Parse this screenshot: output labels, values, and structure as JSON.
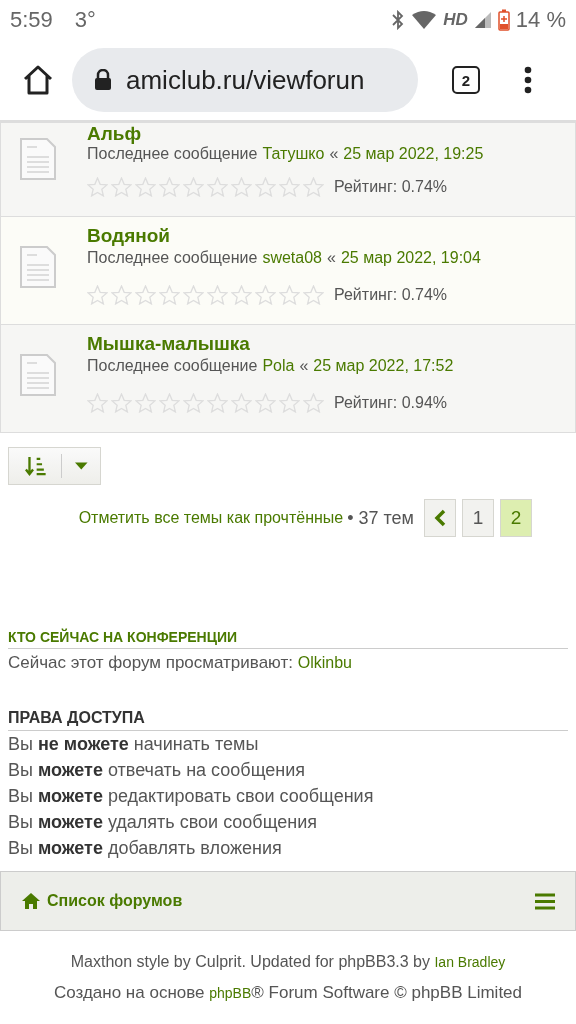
{
  "status_bar": {
    "time": "5:59",
    "temperature": "3°",
    "network": "HD",
    "battery": "14 %"
  },
  "browser": {
    "url": "amiclub.ru/viewforun",
    "tab_count": "2"
  },
  "topics": [
    {
      "title": "Альф",
      "last_post_label": "Последнее сообщение",
      "author": "Татушко",
      "separator": "«",
      "date": "25 мар 2022, 19:25",
      "stars": 0,
      "rating": "Рейтинг: 0.74%"
    },
    {
      "title": "Водяной",
      "last_post_label": "Последнее сообщение",
      "author": "sweta08",
      "separator": "«",
      "date": "25 мар 2022, 19:04",
      "stars": 0,
      "rating": "Рейтинг: 0.74%"
    },
    {
      "title": "Мышка-малышка",
      "last_post_label": "Последнее сообщение",
      "author": "Pola",
      "separator": "«",
      "date": "25 мар 2022, 17:52",
      "stars": 0,
      "rating": "Рейтинг: 0.94%"
    }
  ],
  "mark_read_link": "Отметить все темы как прочтённые",
  "topic_count": "• 37 тем",
  "pagination": [
    {
      "label": "1",
      "selected": false
    },
    {
      "label": "2",
      "selected": true
    }
  ],
  "who_online": {
    "heading": "КТО СЕЙЧАС НА КОНФЕРЕНЦИИ",
    "text": "Сейчас этот форум просматривают:",
    "user": "Olkinbu"
  },
  "permissions": {
    "heading": "ПРАВА ДОСТУПА",
    "lines": [
      "Вы **не можете** начинать темы",
      "Вы **можете** отвечать на сообщения",
      "Вы **можете** редактировать свои сообщения",
      "Вы **можете** удалять свои сообщения",
      "Вы **можете** добавлять вложения"
    ]
  },
  "footer_nav": {
    "label": "Список форумов"
  },
  "credits": {
    "style_text": "Maxthon style by Culprit. Updated for phpBB3.3 by",
    "style_author": "Ian Bradley",
    "powered_prefix": "Создано на основе",
    "powered_link": "phpBB",
    "powered_suffix": "® Forum Software © phpBB Limited"
  }
}
